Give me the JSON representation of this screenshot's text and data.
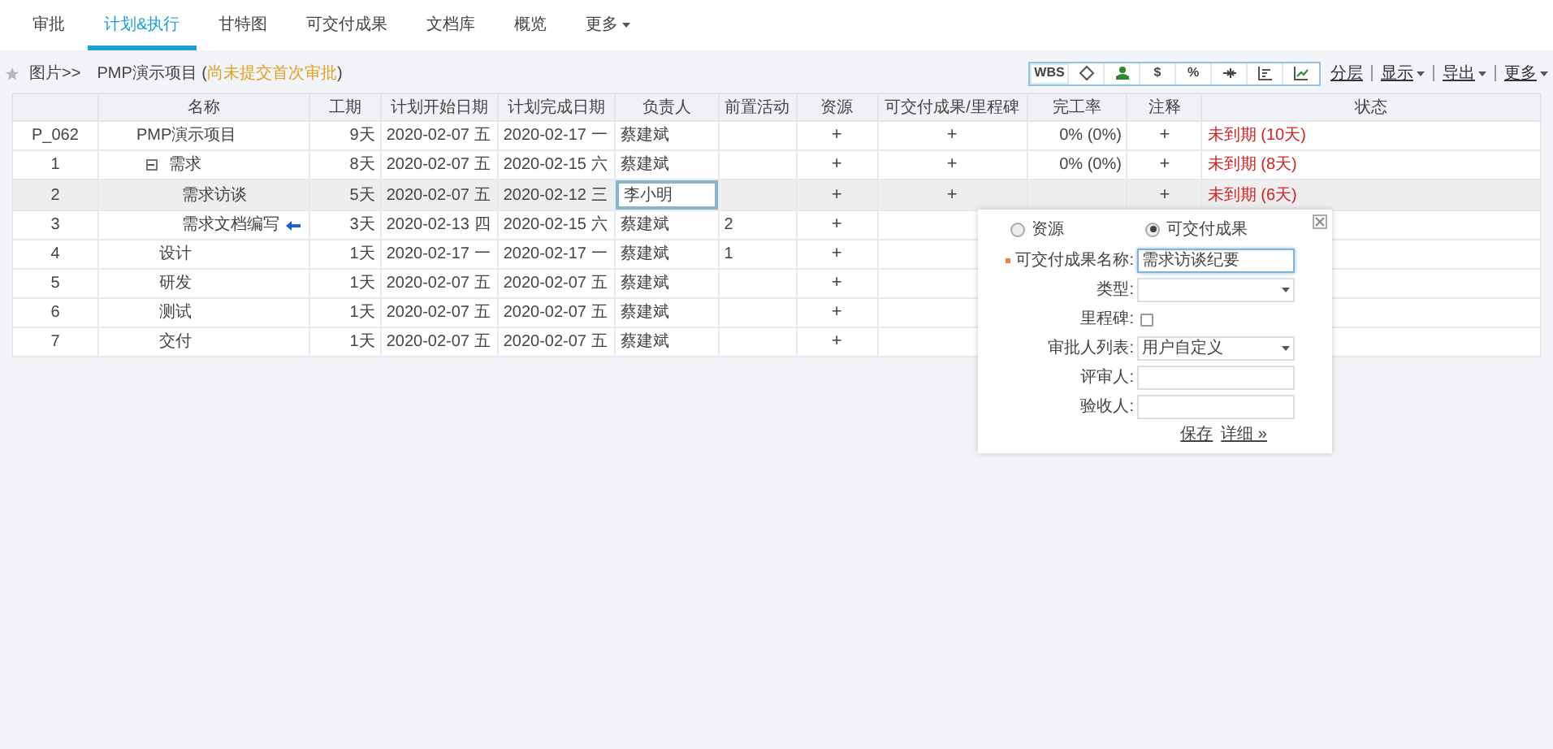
{
  "tabs": [
    {
      "label": "审批",
      "selected": false
    },
    {
      "label": "计划&执行",
      "selected": true
    },
    {
      "label": "甘特图",
      "selected": false
    },
    {
      "label": "可交付成果",
      "selected": false
    },
    {
      "label": "文档库",
      "selected": false
    },
    {
      "label": "概览",
      "selected": false
    },
    {
      "label": "更多",
      "selected": false,
      "dropdown": true
    }
  ],
  "breadcrumb": {
    "root": "图片>>",
    "project": "PMP演示项目",
    "note_open": "(",
    "note": "尚未提交首次审批",
    "note_close": ")"
  },
  "tools": [
    {
      "kind": "wbs",
      "label": "WBS"
    },
    {
      "kind": "diamond"
    },
    {
      "kind": "person"
    },
    {
      "kind": "text",
      "label": "$"
    },
    {
      "kind": "text",
      "label": "%"
    },
    {
      "kind": "arrows"
    },
    {
      "kind": "chart"
    },
    {
      "kind": "chart-up"
    }
  ],
  "links": [
    {
      "label": "分层",
      "dropdown": false
    },
    {
      "label": "显示",
      "dropdown": true
    },
    {
      "label": "导出",
      "dropdown": true
    },
    {
      "label": "更多",
      "dropdown": true
    }
  ],
  "table": {
    "columns": [
      "",
      "名称",
      "工期",
      "计划开始日期",
      "计划完成日期",
      "负责人",
      "前置活动",
      "资源",
      "可交付成果/里程碑",
      "完工率",
      "注释",
      "状态"
    ],
    "rows": [
      {
        "id": "P_062",
        "name": "PMP演示项目",
        "duration": "9天",
        "start": "2020-02-07 五",
        "end": "2020-02-17 一",
        "owner": "蔡建斌",
        "resource": "+",
        "deliverable": "+",
        "completion": "0% (0%)",
        "note": "+",
        "status": "未到期 (10天)",
        "selected": false,
        "editing": false,
        "marker": false,
        "children": [
          {
            "id": "1",
            "name": "需求",
            "expanded": true,
            "duration": "8天",
            "start": "2020-02-07 五",
            "end": "2020-02-15 六",
            "owner": "蔡建斌",
            "resource": "+",
            "deliverable": "+",
            "completion": "0% (0%)",
            "note": "+",
            "status": "未到期 (8天)",
            "selected": false,
            "editing": false,
            "marker": false,
            "children": [
              {
                "id": "2",
                "name": "需求访谈",
                "duration": "5天",
                "start": "2020-02-07 五",
                "end": "2020-02-12 三",
                "owner": "李小明",
                "resource": "+",
                "deliverable": "+",
                "note": "+",
                "status": "未到期 (6天)",
                "selected": true,
                "editing": true,
                "marker": false
              },
              {
                "id": "3",
                "name": "需求文档编写",
                "duration": "3天",
                "start": "2020-02-13 四",
                "end": "2020-02-15 六",
                "owner": "蔡建斌",
                "predecessor": "2",
                "resource": "+",
                "selected": false,
                "editing": false,
                "marker": true
              }
            ]
          },
          {
            "id": "4",
            "name": "设计",
            "duration": "1天",
            "start": "2020-02-17 一",
            "end": "2020-02-17 一",
            "owner": "蔡建斌",
            "predecessor": "1",
            "resource": "+",
            "selected": false,
            "editing": false,
            "marker": false
          },
          {
            "id": "5",
            "name": "研发",
            "duration": "1天",
            "start": "2020-02-07 五",
            "end": "2020-02-07 五",
            "owner": "蔡建斌",
            "resource": "+",
            "selected": false,
            "editing": false,
            "marker": false
          },
          {
            "id": "6",
            "name": "测试",
            "duration": "1天",
            "start": "2020-02-07 五",
            "end": "2020-02-07 五",
            "owner": "蔡建斌",
            "resource": "+",
            "selected": false,
            "editing": false,
            "marker": false
          },
          {
            "id": "7",
            "name": "交付",
            "duration": "1天",
            "start": "2020-02-07 五",
            "end": "2020-02-07 五",
            "owner": "蔡建斌",
            "resource": "+",
            "selected": false,
            "editing": false,
            "marker": false
          }
        ]
      }
    ]
  },
  "popup": {
    "options": [
      {
        "label": "资源",
        "selected": false
      },
      {
        "label": "可交付成果",
        "selected": true
      }
    ],
    "fields": [
      {
        "kind": "text",
        "label": "可交付成果名称:",
        "required": true,
        "value": "需求访谈纪要",
        "focused": true
      },
      {
        "kind": "select",
        "label": "类型:",
        "required": false
      },
      {
        "kind": "checkbox",
        "label": "里程碑:",
        "required": false,
        "checked": false
      },
      {
        "kind": "select",
        "label": "审批人列表:",
        "required": false,
        "value": "用户自定义"
      },
      {
        "kind": "text",
        "label": "评审人:",
        "required": false,
        "focused": false
      },
      {
        "kind": "text",
        "label": "验收人:",
        "required": false,
        "focused": false
      }
    ],
    "actions": [
      "保存",
      "详细 »"
    ]
  }
}
